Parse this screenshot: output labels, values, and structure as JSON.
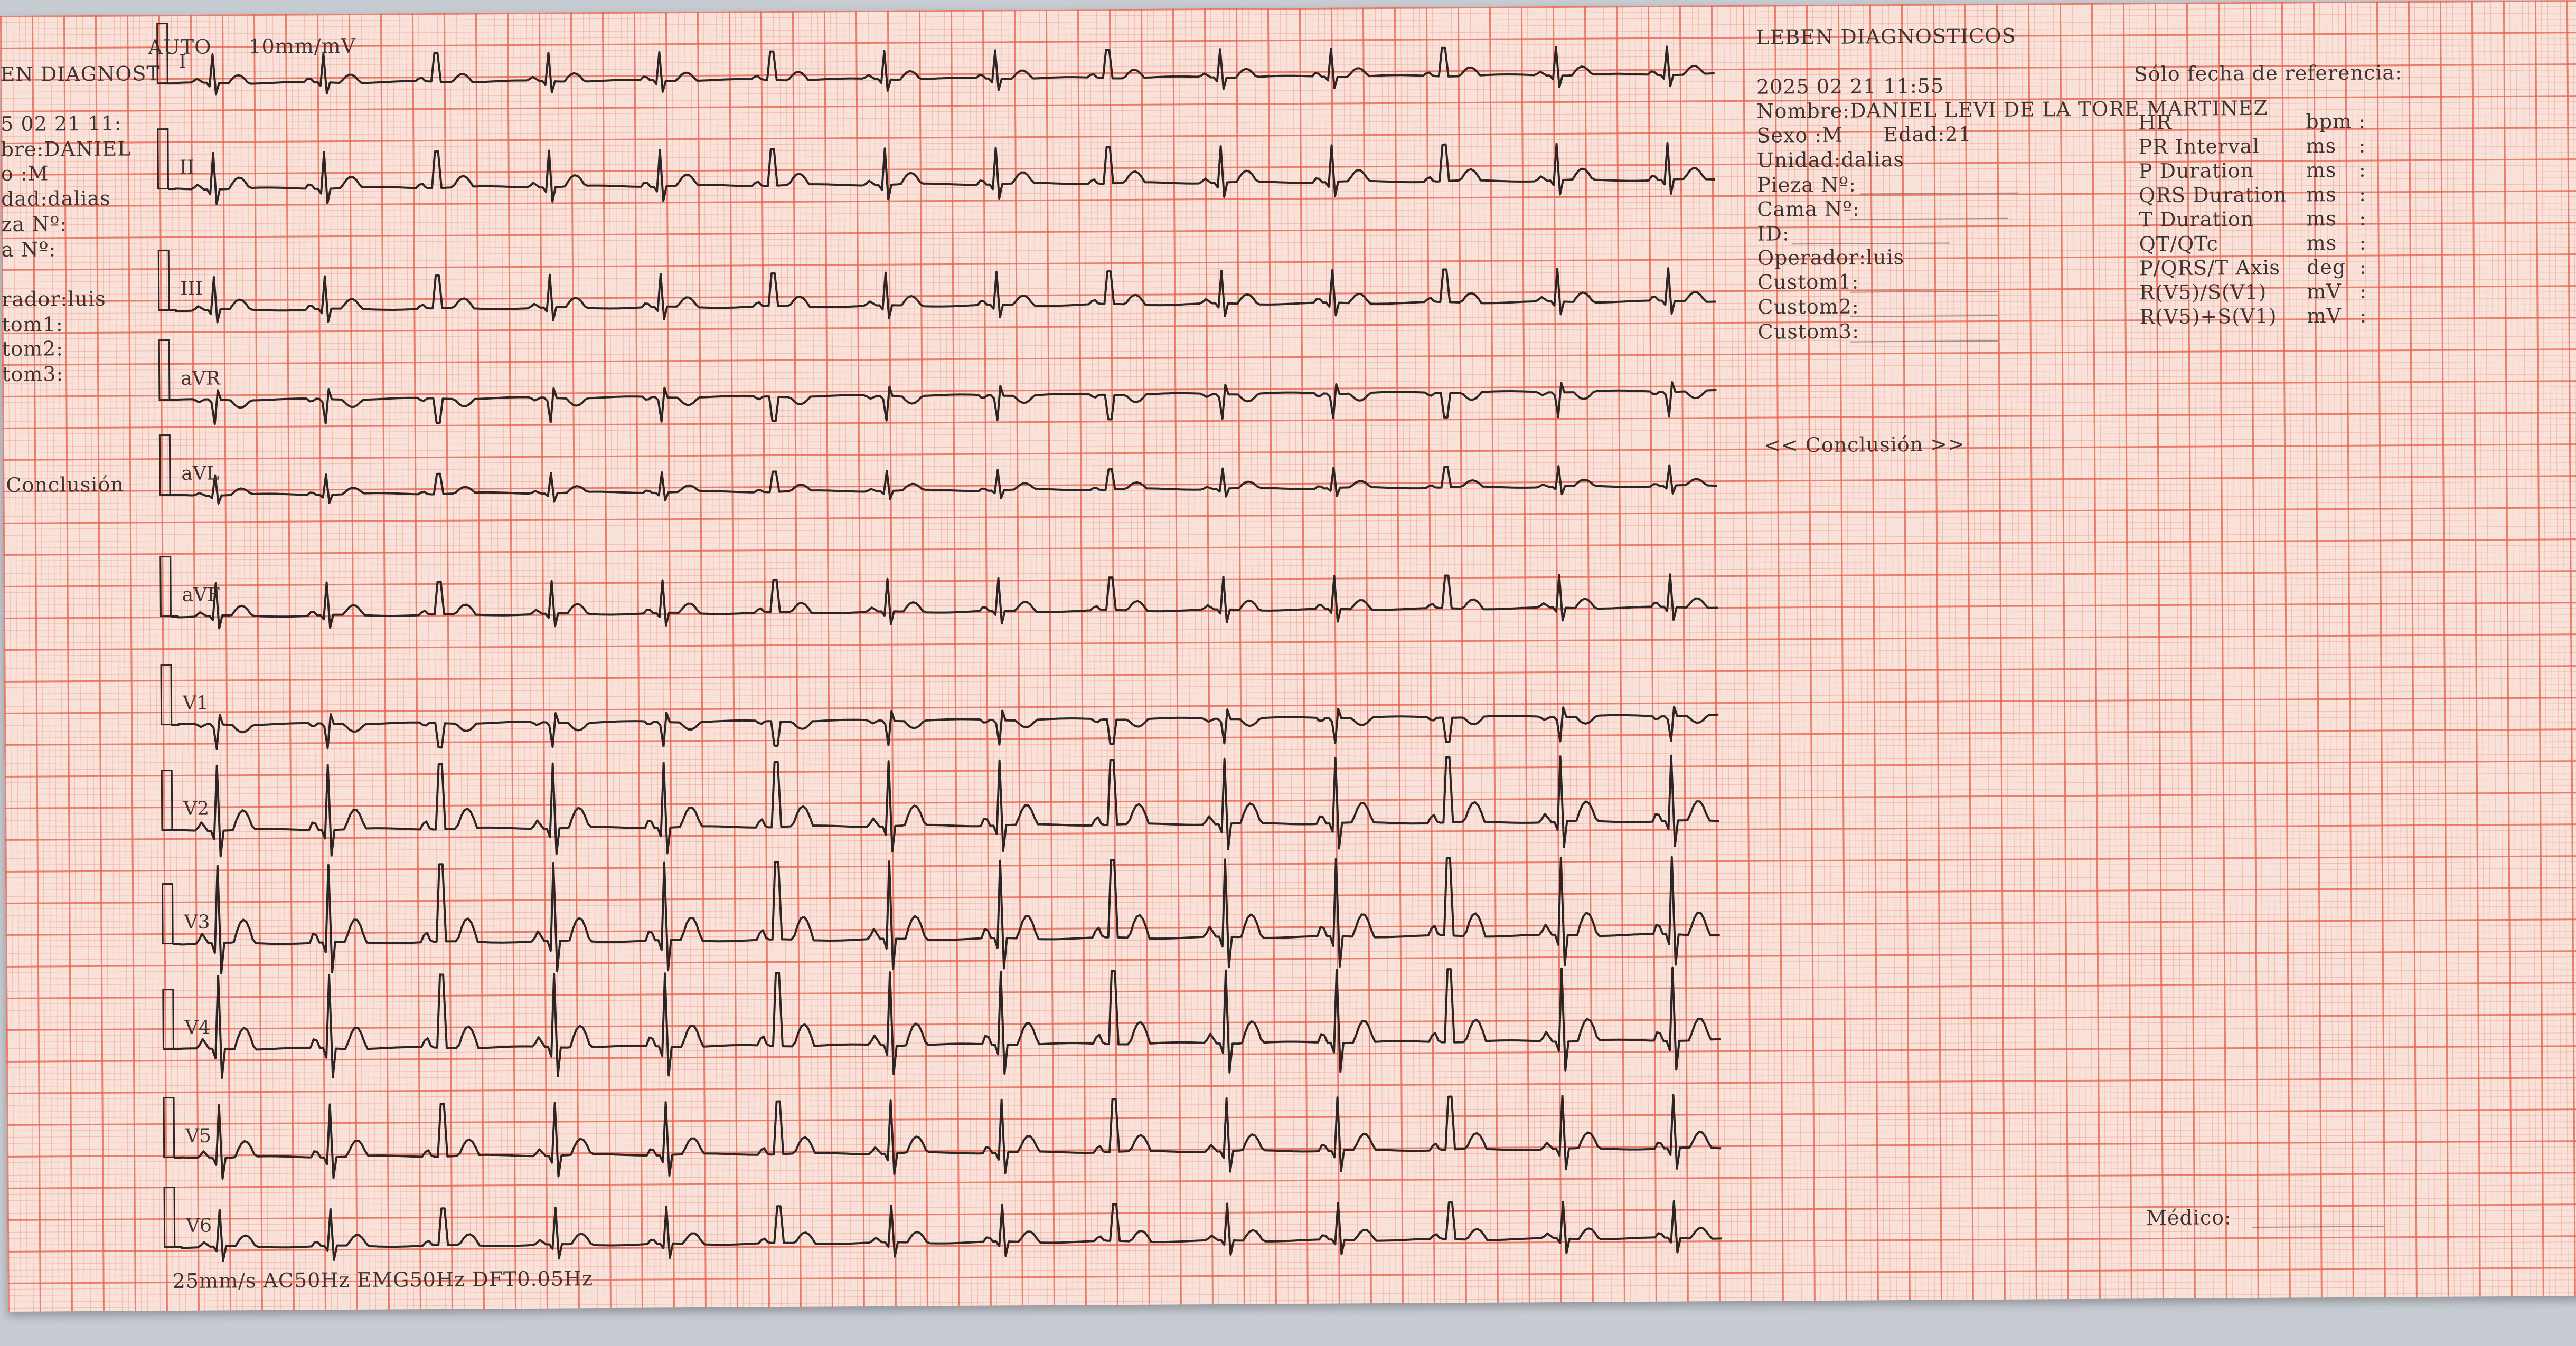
{
  "report": {
    "left_header": "EN DIAGNOST",
    "left_date": "5 02 21 11:",
    "left_name": "bre:DANIEL",
    "left_sex": "o  :M",
    "left_unit": "dad:dalias",
    "left_room": "za Nº:",
    "left_bed": "a Nº:",
    "left_operator": "rador:luis",
    "left_custom1": "tom1:",
    "left_custom2": "tom2:",
    "left_custom3": "tom3:",
    "left_conclusion": "Conclusión",
    "mode": "AUTO",
    "gain": "10mm/mV",
    "footer": "25mm/s  AC50Hz EMG50Hz DFT0.05Hz",
    "clinic": "LEBEN DIAGNOSTICOS",
    "datetime": "2025 02 21 11:55",
    "name": "Nombre:DANIEL LEVI DE LA TORE MARTINEZ",
    "sex": "Sexo  :M",
    "age": "Edad:21",
    "unit": "Unidad:dalias",
    "room": "Pieza Nº:",
    "bed": "Cama Nº:",
    "id": "ID:",
    "operator": "Operador:luis",
    "custom1": "Custom1:",
    "custom2": "Custom2:",
    "custom3": "Custom3:",
    "conclusion": "<< Conclusión >>",
    "reference_only": "Sólo fecha de referencia:",
    "measurements": [
      {
        "label": "HR",
        "unit": "bpm",
        "sep": ":"
      },
      {
        "label": "PR Interval",
        "unit": "ms",
        "sep": ":"
      },
      {
        "label": "P Duration",
        "unit": "ms",
        "sep": ":"
      },
      {
        "label": "QRS Duration",
        "unit": "ms",
        "sep": ":"
      },
      {
        "label": "T Duration",
        "unit": "ms",
        "sep": ":"
      },
      {
        "label": "QT/QTc",
        "unit": "ms",
        "sep": ":"
      },
      {
        "label": "P/QRS/T Axis",
        "unit": "deg",
        "sep": ":"
      },
      {
        "label": "R(V5)/S(V1)",
        "unit": "mV",
        "sep": ":"
      },
      {
        "label": "R(V5)+S(V1)",
        "unit": "mV",
        "sep": ":"
      }
    ],
    "doctor": "Médico:"
  },
  "leads": [
    "I",
    "II",
    "III",
    "aVR",
    "aVL",
    "aVF",
    "V1",
    "V2",
    "V3",
    "V4",
    "V5",
    "V6"
  ],
  "colors": {
    "paper": "#f8e2da",
    "grid": "#e7604c",
    "trace": "#2d2424",
    "background": "#c7ccd3"
  }
}
